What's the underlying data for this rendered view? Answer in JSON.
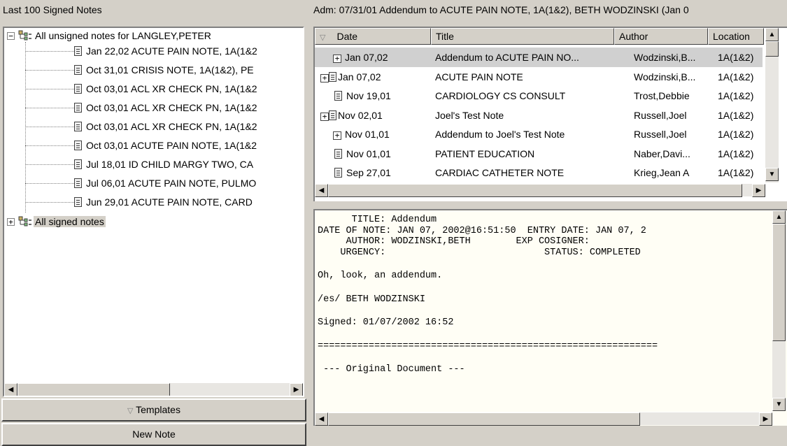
{
  "left": {
    "title": "Last 100 Signed Notes",
    "unsigned_root": "All unsigned notes for LANGLEY,PETER",
    "unsigned_notes": [
      "Jan 22,02  ACUTE PAIN NOTE, 1A(1&2",
      "Oct 31,01  CRISIS NOTE, 1A(1&2), PE",
      "Oct 03,01  ACL XR CHECK PN, 1A(1&2",
      "Oct 03,01  ACL XR CHECK PN, 1A(1&2",
      "Oct 03,01  ACL XR CHECK PN, 1A(1&2",
      "Oct 03,01  ACUTE PAIN NOTE, 1A(1&2",
      "Jul 18,01  ID CHILD MARGY TWO, CA",
      "Jul 06,01  ACUTE PAIN NOTE, PULMO",
      "Jun 29,01  ACUTE PAIN NOTE, CARD"
    ],
    "signed_root": "All signed notes",
    "templates_button": "Templates",
    "new_note_button": "New Note"
  },
  "right": {
    "adm_title": "Adm: 07/31/01  Addendum to ACUTE PAIN NOTE, 1A(1&2), BETH WODZINSKI  (Jan 0",
    "columns": [
      "Date",
      "Title",
      "Author",
      "Location"
    ],
    "rows": [
      {
        "icon": "plus",
        "date": "Jan 07,02",
        "title": "Addendum to ACUTE PAIN NO...",
        "author": "Wodzinski,B...",
        "location": "1A(1&2)"
      },
      {
        "icon": "plus-doc",
        "date": "Jan 07,02",
        "title": "ACUTE PAIN NOTE",
        "author": "Wodzinski,B...",
        "location": "1A(1&2)"
      },
      {
        "icon": "doc",
        "date": "Nov 19,01",
        "title": "CARDIOLOGY CS CONSULT",
        "author": "Trost,Debbie",
        "location": "1A(1&2)"
      },
      {
        "icon": "plus-doc",
        "date": "Nov 02,01",
        "title": "Joel's Test Note",
        "author": "Russell,Joel",
        "location": "1A(1&2)"
      },
      {
        "icon": "plus",
        "date": "Nov 01,01",
        "title": "Addendum to Joel's Test Note",
        "author": "Russell,Joel",
        "location": "1A(1&2)"
      },
      {
        "icon": "doc",
        "date": "Nov 01,01",
        "title": "PATIENT EDUCATION",
        "author": "Naber,Davi...",
        "location": "1A(1&2)"
      },
      {
        "icon": "doc",
        "date": "Sep 27,01",
        "title": "CARDIAC CATHETER NOTE",
        "author": "Krieg,Jean A",
        "location": "1A(1&2)"
      }
    ],
    "note_lines": [
      "      TITLE: Addendum",
      "DATE OF NOTE: JAN 07, 2002@16:51:50  ENTRY DATE: JAN 07, 2",
      "     AUTHOR: WODZINSKI,BETH        EXP COSIGNER:",
      "    URGENCY:                            STATUS: COMPLETED",
      "",
      "Oh, look, an addendum.",
      "",
      "/es/ BETH WODZINSKI",
      "",
      "Signed: 01/07/2002 16:52",
      "",
      "============================================================",
      "",
      " --- Original Document ---"
    ]
  }
}
